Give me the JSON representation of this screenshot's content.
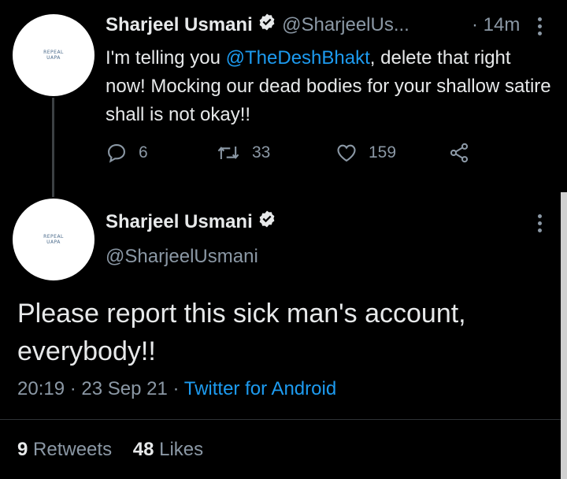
{
  "tweet1": {
    "name": "Sharjeel Usmani",
    "handle": "@SharjeelUs...",
    "time": "· 14m",
    "avatar_text": [
      "REPEAL",
      "UAPA"
    ],
    "text_before": "I'm telling you ",
    "mention": "@TheDeshBhakt",
    "text_after": ", delete that right now! Mocking our dead bodies for your shallow satire shall is not okay!!",
    "replies": "6",
    "retweets": "33",
    "likes": "159"
  },
  "tweet2": {
    "name": "Sharjeel Usmani",
    "handle": "@SharjeelUsmani",
    "avatar_text": [
      "REPEAL",
      "UAPA"
    ],
    "text": "Please report this sick man's account, everybody!!",
    "time": "20:19",
    "date": "23 Sep 21",
    "source": "Twitter for Android",
    "retweet_count": "9",
    "retweet_label": "Retweets",
    "like_count": "48",
    "like_label": "Likes"
  },
  "colors": {
    "background": "#000000",
    "text": "#e7e9ea",
    "muted": "#8b98a5",
    "link": "#1d9bf0"
  },
  "icons": [
    "verified-badge-icon",
    "more-options-icon",
    "reply-icon",
    "retweet-icon",
    "like-icon",
    "share-icon"
  ]
}
